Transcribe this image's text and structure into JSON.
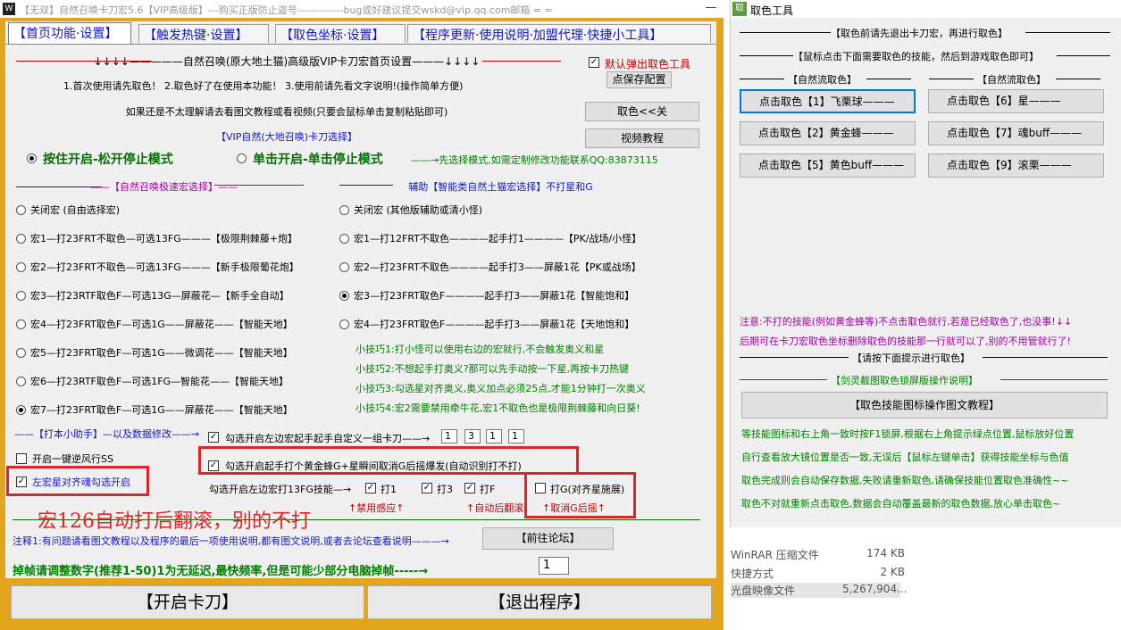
{
  "main_window": {
    "title": "【无双】自然召唤卡刀宏5.6【VIP高级版】---购买正版防止盗号-------------bug或好建议提交wskd@vip.qq.com邮箱 = =",
    "icon_glyph": "W",
    "minimize_glyph": "—",
    "tabs": [
      {
        "label": "【首页功能·设置】"
      },
      {
        "label": "【触发热键·设置】"
      },
      {
        "label": "【取色坐标·设置】"
      },
      {
        "label": "【程序更新·使用说明·加盟代理·快捷小工具】"
      }
    ],
    "header": "↓↓↓↓—————自然召唤(原大地土猫)高级版VIP卡刀宏首页设置———↓↓↓↓",
    "steps": "1.首次使用请先取色！  2.取色好了在使用本功能！  3.使用前请先看文字说明!(操作简单方便)",
    "tutorial_note": "如果还是不太理解请去看图文教程或看视频(只要会鼠标单击复制粘贴即可)",
    "vip_select": "【VIP自然(大地召唤)卡刀选择】",
    "mode_hold": "按住开启-松开停止模式",
    "mode_click": "单击开启-单击停止模式",
    "mode_note": "——→先选择模式,如需定制修改功能联系QQ:83873115",
    "left_header": "——【自然召唤极速宏选择】——",
    "right_header": "辅助【智能类自然土猫宏选择】不打星和G",
    "left_options": [
      {
        "label": "关闭宏 (自由选择宏)",
        "checked": false
      },
      {
        "label": "宏1—打23FRT不取色—可选13FG———【极限荆棘藤+炮】",
        "checked": false
      },
      {
        "label": "宏2—打23FRT不取色—可选13FG———【新手极限葡花炮】",
        "checked": false
      },
      {
        "label": "宏3—打23RTF取色F—可选13G—屏蔽花—【新手全自动】",
        "checked": false
      },
      {
        "label": "宏4—打23FRT取色F—可选1G——屏蔽花——【智能天地】",
        "checked": false
      },
      {
        "label": "宏5—打23FRT取色F—可选1G——微调花——【智能天地】",
        "checked": false
      },
      {
        "label": "宏6—打23RTF取色F—可选1FG—智能花——【智能天地】",
        "checked": false
      },
      {
        "label": "宏7—打23FRT取色F—可选1G——屏蔽花——【智能天地】",
        "checked": true
      }
    ],
    "right_options": [
      {
        "label": "关闭宏 (其他版辅助或清小怪)",
        "checked": false
      },
      {
        "label": "宏1—打12FRT不取色————起手打1————【PK/战场/小怪】",
        "checked": false
      },
      {
        "label": "宏2—打23FRT不取色————起手打3——屏蔽1花【PK或战场】",
        "checked": false
      },
      {
        "label": "宏3—打23FRT取色F————起手打3——屏蔽1花【智能饱和】",
        "checked": true
      },
      {
        "label": "宏4—打23FRT取色F————起手打3——屏蔽1花【天地饱和】",
        "checked": false
      }
    ],
    "tips": [
      "小技巧1:打小怪可以使用右边的宏就行,不会触发奥义和星",
      "小技巧2:不想起手打奥义?那可以先手动按一下星,再按卡刀热键",
      "小技巧3:勾选星对齐奥义,奥义加点必须25点,才能1分钟打一次奥义",
      "小技巧4:宏2需要禁用牵牛花,宏1不取色也是极限荆棘藤和向日葵!"
    ],
    "default_popup_label": "默认弹出取色工具",
    "default_popup_checked": true,
    "save_config_button": "点保存配置",
    "pick_color_button": "取色<<关",
    "video_tutorial_button": "视频教程",
    "helper_label": "——【打本小助手】—以及数据修改——→",
    "custom_combo_label": "勾选开启左边宏起手起手自定义一组卡刀——→",
    "custom_combo_values": [
      "1",
      "3",
      "1",
      "1"
    ],
    "bee_label": "勾选开启起手打个黄金蜂G+星瞬间取消G后摇爆发(自动识别打不打)",
    "bee_checked": true,
    "dodge_label": "开启一键逆风行SS",
    "dodge_checked": false,
    "star_align_label": "左宏星对齐魂勾选开启",
    "star_align_checked": true,
    "left_macro_skill_label": "勾选开启左边宏打13FG技能—→",
    "skill_checks": [
      {
        "label": "打1",
        "checked": true
      },
      {
        "label": "打3",
        "checked": true
      },
      {
        "label": "打F",
        "checked": true
      }
    ],
    "hit_g_label": "打G(对齐星施展)",
    "hit_g_checked": false,
    "disable_sense_note": "↑禁用感应↑",
    "auto_roll_note": "↑自动后翻滚",
    "cancel_swing_note": "↑取消G后摇↑",
    "annotation_overlay": "宏126自动打后翻滚，别的不打",
    "note1": "注释1:有问题请看图文教程以及程序的最后一项使用说明,都有图文说明,或者去论坛查看说明———→",
    "forum_button": "【前往论坛】",
    "frame_drop_label": "掉帧请调整数字(推荐1-50)1为无延迟,最快频率,但是可能少部分电脑掉帧-----→",
    "frame_drop_value": "1",
    "start_button": "【开启卡刀】",
    "exit_button": "【退出程序】"
  },
  "color_tool": {
    "title": "取色工具",
    "icon_glyph": "取",
    "note_top": "【取色前请先退出卡刀宏，再进行取色】",
    "note_click": "【鼠标点击下面需要取色的技能，然后到游戏取色即可】",
    "group_left": "【自然流取色】",
    "group_right": "【自然流取色】",
    "buttons": [
      {
        "label": "点击取色【1】飞栗球———",
        "selected": true
      },
      {
        "label": "点击取色【6】星———",
        "selected": false
      },
      {
        "label": "点击取色【2】黄金蜂———",
        "selected": false
      },
      {
        "label": "点击取色【7】魂buff———",
        "selected": false
      },
      {
        "label": "点击取色【5】黄色buff———",
        "selected": false
      },
      {
        "label": "点击取色【9】滚栗———",
        "selected": false
      }
    ],
    "warning1": "注意:不打的技能(例如黄金蜂等)不点击取色就行,若是已经取色了,也没事!↓↓",
    "warning2": "后期可在卡刀宏取色坐标删除取色的技能那一行就可以了,别的不用管就行了!",
    "prompt": "【请按下面提示进行取色】",
    "lock_header": "【剑灵截图取色锁屏版操作说明】",
    "tutorial_button": "【取色技能图标操作图文教程】",
    "instructions": [
      "等技能图标和右上角一致时按F1锁屏,根据右上角提示绿点位置,鼠标放好位置",
      "自行查看放大镜位置是否一致,无误后【鼠标左键单击】获得技能坐标与色值",
      "取色完成则会自动保存数据,失败请重新取色,请确保技能位置取色准确性~~",
      "取色不对就重新点击取色,数据会自动覆盖最新的取色数据,放心单击取色~"
    ]
  },
  "explorer": {
    "rows": [
      {
        "type": "WinRAR 压缩文件",
        "size": "174 KB"
      },
      {
        "type": "快捷方式",
        "size": "2 KB"
      },
      {
        "type": "光盘映像文件",
        "size": "5,267,904..."
      }
    ]
  },
  "colors": {
    "window_border": "#e3a51b",
    "tab_text": "#1515c8",
    "red": "#c00000",
    "purple": "#a000a0",
    "green": "#008000",
    "annotation_red": "#e0242a",
    "highlight_blue": "#0078d7"
  }
}
